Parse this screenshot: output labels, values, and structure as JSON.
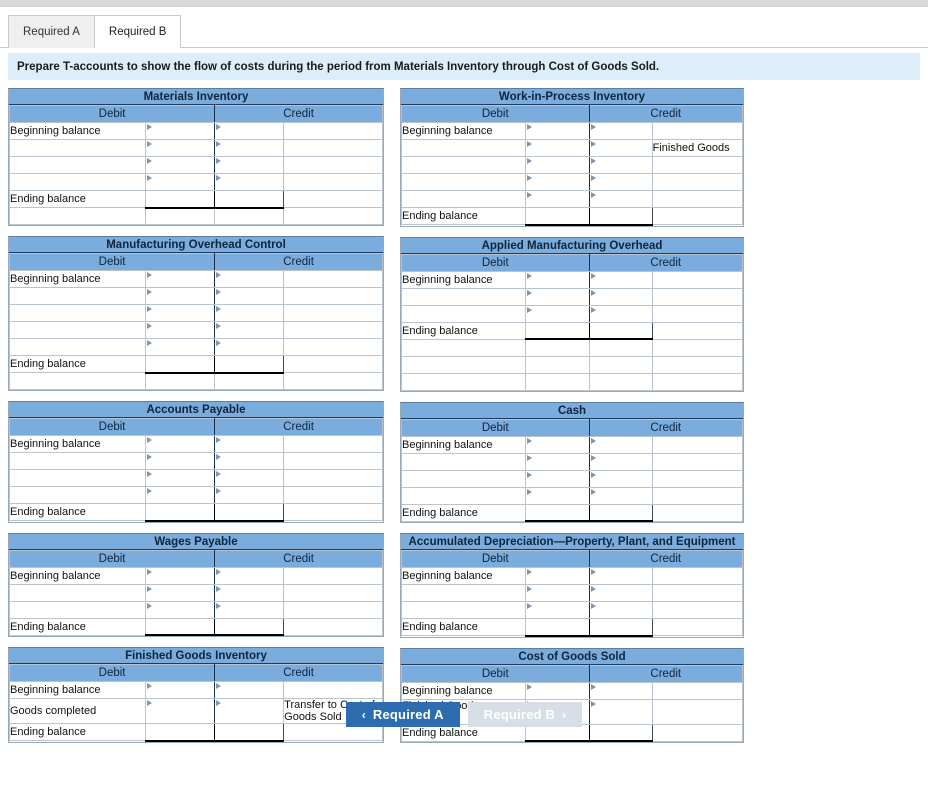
{
  "tabs": [
    {
      "label": "Required A",
      "active": false
    },
    {
      "label": "Required B",
      "active": true
    }
  ],
  "instruction": "Prepare T-accounts to show the flow of costs during the period from Materials Inventory through Cost of Goods Sold.",
  "columns": {
    "debit": "Debit",
    "credit": "Credit"
  },
  "row_labels": {
    "beginning": "Beginning balance",
    "ending": "Ending balance"
  },
  "colors": {
    "header_blue": "#7aadde",
    "banner_blue": "#ddeefb",
    "active_button": "#2e6cb0",
    "disabled_button": "#d7dee7",
    "cell_border": "#90a4b8"
  },
  "accounts": [
    {
      "title": "Materials Inventory",
      "side": "left",
      "rows": [
        {
          "label": "Beginning balance",
          "credit_label": ""
        },
        {
          "label": "",
          "credit_label": ""
        },
        {
          "label": "",
          "credit_label": ""
        },
        {
          "label": "",
          "credit_label": ""
        }
      ],
      "ending_label": "Ending balance",
      "filler": 1
    },
    {
      "title": "Work-in-Process Inventory",
      "side": "right",
      "rows": [
        {
          "label": "Beginning balance",
          "credit_label": ""
        },
        {
          "label": "",
          "credit_label": "Finished Goods"
        },
        {
          "label": "",
          "credit_label": ""
        },
        {
          "label": "",
          "credit_label": ""
        },
        {
          "label": "",
          "credit_label": ""
        }
      ],
      "ending_label": "Ending balance",
      "filler": 0
    },
    {
      "title": "Manufacturing Overhead Control",
      "side": "left",
      "rows": [
        {
          "label": "Beginning balance",
          "credit_label": ""
        },
        {
          "label": "",
          "credit_label": ""
        },
        {
          "label": "",
          "credit_label": ""
        },
        {
          "label": "",
          "credit_label": ""
        },
        {
          "label": "",
          "credit_label": ""
        }
      ],
      "ending_label": "Ending balance",
      "filler": 1
    },
    {
      "title": "Applied Manufacturing Overhead",
      "side": "right",
      "rows": [
        {
          "label": "Beginning balance",
          "credit_label": ""
        },
        {
          "label": "",
          "credit_label": ""
        },
        {
          "label": "",
          "credit_label": ""
        }
      ],
      "ending_label": "Ending balance",
      "filler": 3
    },
    {
      "title": "Accounts Payable",
      "side": "left",
      "rows": [
        {
          "label": "Beginning balance",
          "credit_label": ""
        },
        {
          "label": "",
          "credit_label": ""
        },
        {
          "label": "",
          "credit_label": ""
        },
        {
          "label": "",
          "credit_label": ""
        }
      ],
      "ending_label": "Ending balance",
      "filler": 0
    },
    {
      "title": "Cash",
      "side": "right",
      "rows": [
        {
          "label": "Beginning balance",
          "credit_label": ""
        },
        {
          "label": "",
          "credit_label": ""
        },
        {
          "label": "",
          "credit_label": ""
        },
        {
          "label": "",
          "credit_label": ""
        }
      ],
      "ending_label": "Ending balance",
      "filler": 0
    },
    {
      "title": "Wages Payable",
      "side": "left",
      "rows": [
        {
          "label": "Beginning balance",
          "credit_label": ""
        },
        {
          "label": "",
          "credit_label": ""
        },
        {
          "label": "",
          "credit_label": ""
        }
      ],
      "ending_label": "Ending balance",
      "filler": 0
    },
    {
      "title": "Accumulated Depreciation—Property, Plant, and Equipment",
      "side": "right",
      "rows": [
        {
          "label": "Beginning balance",
          "credit_label": ""
        },
        {
          "label": "",
          "credit_label": ""
        },
        {
          "label": "",
          "credit_label": ""
        }
      ],
      "ending_label": "Ending balance",
      "filler": 0
    },
    {
      "title": "Finished Goods Inventory",
      "side": "left",
      "rows": [
        {
          "label": "Beginning balance",
          "credit_label": ""
        },
        {
          "label": "Goods completed",
          "credit_label": "Transfer to Cost of Goods Sold"
        }
      ],
      "ending_label": "Ending balance",
      "filler": 0
    },
    {
      "title": "Cost of Goods Sold",
      "side": "right",
      "rows": [
        {
          "label": "Beginning balance",
          "credit_label": ""
        },
        {
          "label": "Finished Goods Inventory",
          "credit_label": ""
        }
      ],
      "ending_label": "Ending balance",
      "filler": 0
    }
  ],
  "nav": {
    "prev": {
      "label": "Required A",
      "icon": "chevron-left-icon",
      "enabled": true
    },
    "next": {
      "label": "Required B",
      "icon": "chevron-right-icon",
      "enabled": false
    }
  }
}
